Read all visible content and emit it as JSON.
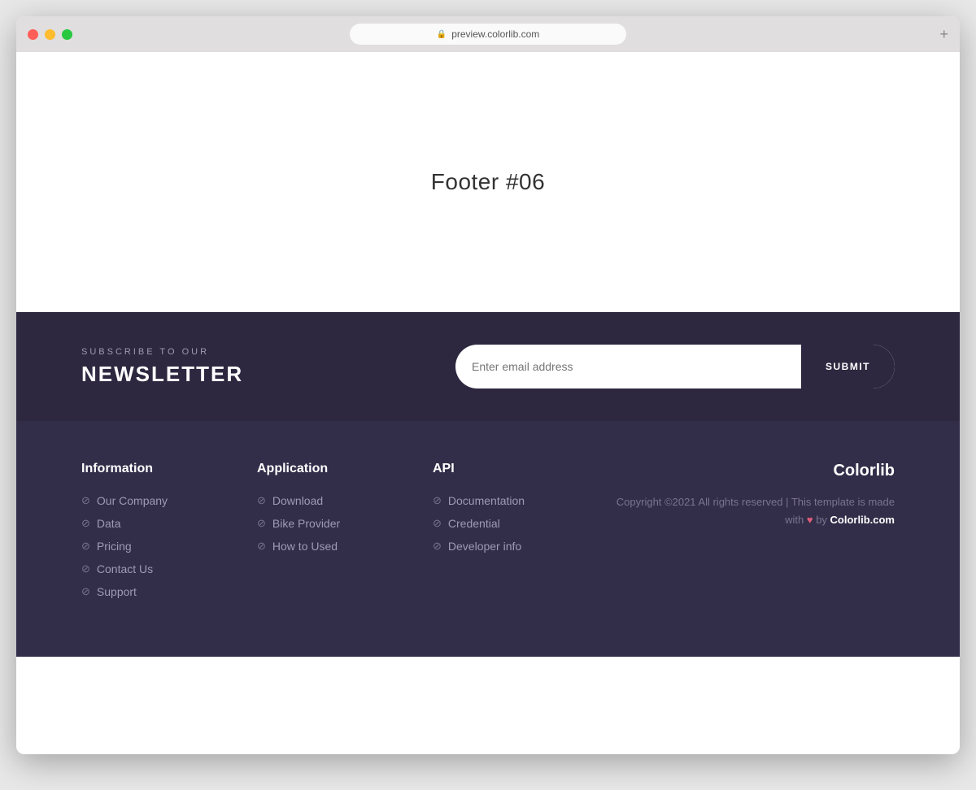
{
  "browser": {
    "url": "preview.colorlib.com",
    "tab_add_label": "+"
  },
  "main": {
    "page_title": "Footer #06"
  },
  "newsletter": {
    "sub_label": "SUBSCRIBE TO OUR",
    "main_label": "NEWSLETTER",
    "input_placeholder": "Enter email address",
    "submit_label": "SUBMIT"
  },
  "footer": {
    "columns": [
      {
        "id": "information",
        "title": "Information",
        "links": [
          {
            "label": "Our Company",
            "href": "#"
          },
          {
            "label": "Data",
            "href": "#"
          },
          {
            "label": "Pricing",
            "href": "#"
          },
          {
            "label": "Contact Us",
            "href": "#"
          },
          {
            "label": "Support",
            "href": "#"
          }
        ]
      },
      {
        "id": "application",
        "title": "Application",
        "links": [
          {
            "label": "Download",
            "href": "#"
          },
          {
            "label": "Bike Provider",
            "href": "#"
          },
          {
            "label": "How to Used",
            "href": "#"
          }
        ]
      },
      {
        "id": "api",
        "title": "API",
        "links": [
          {
            "label": "Documentation",
            "href": "#"
          },
          {
            "label": "Credential",
            "href": "#"
          },
          {
            "label": "Developer info",
            "href": "#"
          }
        ]
      }
    ],
    "brand": {
      "name": "Colorlib",
      "copyright": "Copyright ©2021 All rights reserved | This template is made with",
      "heart": "♥",
      "by_text": "by",
      "link_label": "Colorlib.com"
    }
  }
}
